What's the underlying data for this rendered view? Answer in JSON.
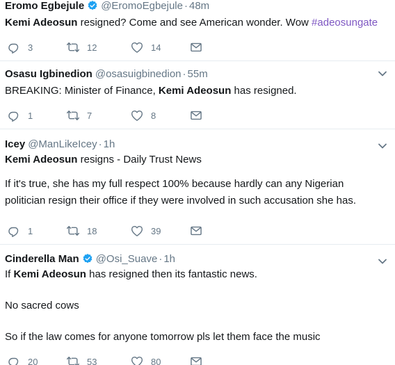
{
  "tweets": [
    {
      "name": "Eromo Egbejule",
      "verified": true,
      "handle": "@EromoEgbejule",
      "time": "48m",
      "text_parts": {
        "bold": "Kemi Adeosun",
        "rest": " resigned? Come and see American wonder. Wow ",
        "hashtag": "#adeosungate"
      },
      "replies": "3",
      "retweets": "12",
      "likes": "14"
    },
    {
      "name": "Osasu Igbinedion",
      "verified": false,
      "handle": "@osasuigbinedion",
      "time": "55m",
      "text_parts": {
        "pre": "BREAKING: Minister of Finance, ",
        "bold": "Kemi Adeosun",
        "rest": " has resigned."
      },
      "replies": "1",
      "retweets": "7",
      "likes": "8"
    },
    {
      "name": "Icey",
      "verified": false,
      "handle": "@ManLikeIcey",
      "time": "1h",
      "text_parts": {
        "bold": "Kemi Adeosun",
        "rest": " resigns - Daily Trust News",
        "para2_line1": "If it's true, she has my full respect 100% because hardly can any Nigerian",
        "para2_line2": "politician resign their office if they were involved in such accusation she has."
      },
      "replies": "1",
      "retweets": "18",
      "likes": "39"
    },
    {
      "name": "Cinderella Man",
      "verified": true,
      "handle": "@Osi_Suave",
      "time": "1h",
      "text_parts": {
        "pre": "If ",
        "bold": "Kemi Adeosun",
        "rest": " has resigned then its fantastic news.",
        "para2": "No sacred cows",
        "para3": "So if the law comes for anyone tomorrow pls let them face the music"
      },
      "replies": "20",
      "retweets": "53",
      "likes": "80"
    }
  ],
  "separator": "·",
  "icons": {
    "reply": "reply-icon",
    "retweet": "retweet-icon",
    "like": "heart-icon",
    "dm": "envelope-icon",
    "verified": "verified-badge-icon",
    "more": "chevron-down-icon"
  },
  "colors": {
    "text": "#14171a",
    "muted": "#657786",
    "hashtag": "#7e57c2",
    "verified": "#1da1f2",
    "divider": "#e6ecf0"
  }
}
